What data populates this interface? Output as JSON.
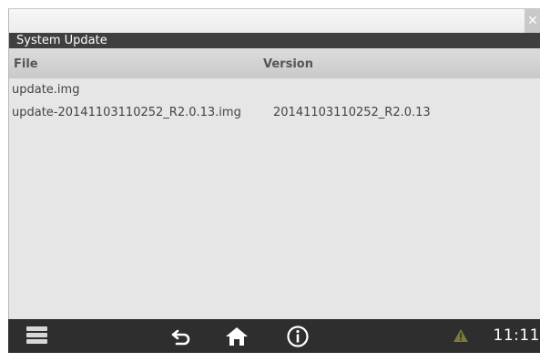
{
  "dialog": {
    "title": "System Update",
    "close_glyph": "✕"
  },
  "columns": {
    "file": "File",
    "version": "Version"
  },
  "files": [
    {
      "file": "update.img",
      "version": ""
    },
    {
      "file": "update-20141103110252_R2.0.13.img",
      "version": "20141103110252_R2.0.13"
    }
  ],
  "navbar": {
    "icons": [
      "menu-icon",
      "back-icon",
      "home-icon",
      "info-icon",
      "warning-icon"
    ],
    "clock": "11:11"
  }
}
